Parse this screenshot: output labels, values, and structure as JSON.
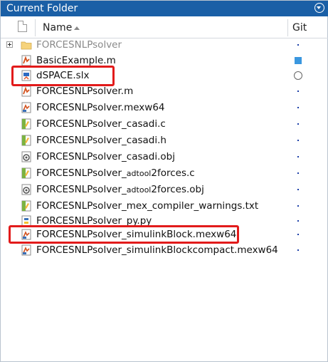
{
  "panel": {
    "title": "Current Folder",
    "menu_icon": "circle-chevron-down-icon"
  },
  "header": {
    "file_type_icon": "file-icon",
    "name_label": "Name",
    "git_label": "Git",
    "sort_icon": "sort-ascending-icon"
  },
  "rows": [
    {
      "name": "FORCESNLPsolver",
      "type": "folder",
      "git": "dot",
      "expandable": true,
      "dimmed": true
    },
    {
      "name": "BasicExample.m",
      "type": "m-script",
      "git": "square"
    },
    {
      "name": "dSPACE.slx",
      "type": "simulink-model",
      "git": "circle"
    },
    {
      "name": "FORCESNLPsolver.m",
      "type": "m-script",
      "git": "dot"
    },
    {
      "name": "FORCESNLPsolver.mexw64",
      "type": "mex",
      "git": "dot"
    },
    {
      "name": "FORCESNLPsolver_casadi.c",
      "type": "c-source",
      "git": "dot"
    },
    {
      "name": "FORCESNLPsolver_casadi.h",
      "type": "c-header",
      "git": "dot"
    },
    {
      "name": "FORCESNLPsolver_casadi.obj",
      "type": "object",
      "git": "dot"
    },
    {
      "name_prefix": "FORCESNLPsolver_",
      "name_sub": "adtool",
      "name_suffix": "2forces.c",
      "type": "c-source",
      "git": "dot"
    },
    {
      "name_prefix": "FORCESNLPsolver_",
      "name_sub": "adtool",
      "name_suffix": "2forces.obj",
      "type": "object",
      "git": "dot"
    },
    {
      "name": "FORCESNLPsolver_mex_compiler_warnings.txt",
      "type": "text",
      "git": "dot"
    },
    {
      "name": "FORCESNLPsolver_py.py",
      "type": "python",
      "git": "dot"
    },
    {
      "name": "FORCESNLPsolver_simulinkBlock.mexw64",
      "type": "mex",
      "git": "dot"
    },
    {
      "name": "FORCESNLPsolver_simulinkBlockcompact.mexw64",
      "type": "mex",
      "git": "dot"
    }
  ],
  "colors": {
    "title_bar": "#1a5fa6",
    "highlight": "#e21b1b",
    "git_blue": "#3a97df"
  }
}
